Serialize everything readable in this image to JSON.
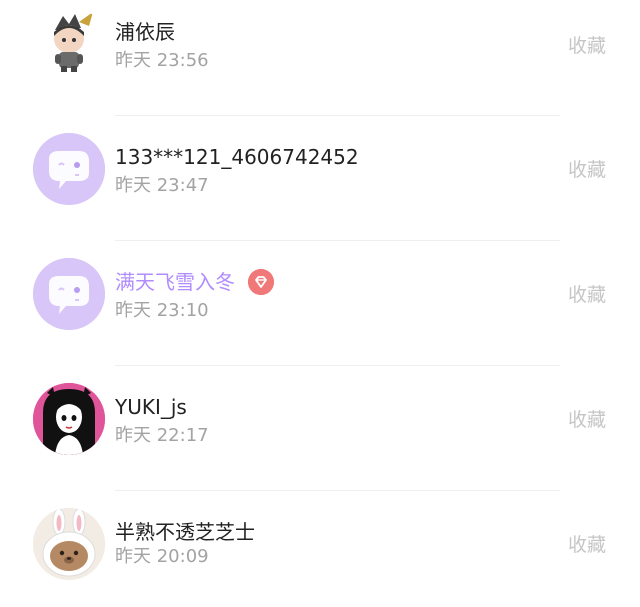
{
  "items": [
    {
      "name": "浦依辰",
      "time": "昨天 23:56",
      "action": "收藏",
      "avatar": "chibi-character-avatar"
    },
    {
      "name": "133***121_4606742452",
      "time": "昨天 23:47",
      "action": "收藏",
      "avatar": "default-chat-bubble-avatar"
    },
    {
      "name": "满天飞雪入冬",
      "time": "昨天 23:10",
      "action": "收藏",
      "avatar": "default-chat-bubble-avatar",
      "badge": "diamond-vip-icon"
    },
    {
      "name": "YUKI_js",
      "time": "昨天 22:17",
      "action": "收藏",
      "avatar": "anime-girl-avatar"
    },
    {
      "name": "半熟不透芝芝士",
      "time": "昨天 20:09",
      "action": "收藏",
      "avatar": "bunny-hood-bear-avatar"
    }
  ],
  "colors": {
    "name": "#222222",
    "vip_name": "#b18cff",
    "time": "#a3a3a3",
    "action": "#c6c6c6",
    "default_avatar_bg": "#d7c6f7",
    "vip_badge": "#f07878"
  }
}
